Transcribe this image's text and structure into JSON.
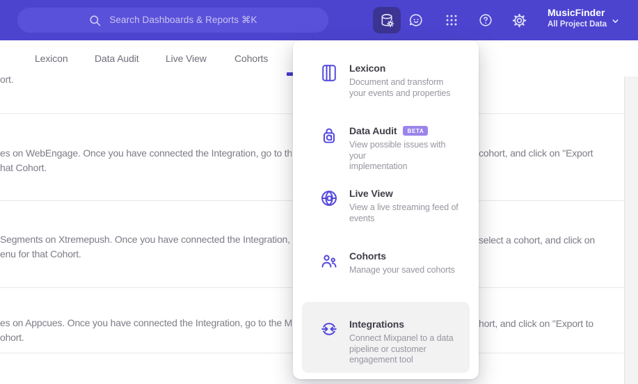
{
  "header": {
    "search": {
      "placeholder": "Search Dashboards & Reports ⌘K",
      "icon": "search-icon"
    },
    "nav_icons": [
      "data-management-icon",
      "feedback-bubble-icon",
      "apps-grid-icon",
      "help-icon",
      "settings-gear-icon"
    ],
    "active_nav_icon": "data-management-icon",
    "project": {
      "name": "MusicFinder",
      "scope": "All Project Data"
    }
  },
  "tabs": [
    {
      "label": "Lexicon"
    },
    {
      "label": "Data Audit"
    },
    {
      "label": "Live View"
    },
    {
      "label": "Cohorts"
    }
  ],
  "menu": {
    "items": [
      {
        "title": "Lexicon",
        "icon": "book-icon",
        "desc_lines": [
          "Document and transform",
          "your events and properties"
        ]
      },
      {
        "title": "Data Audit",
        "icon": "audit-lock-icon",
        "badge": "BETA",
        "desc_lines": [
          "View possible issues with your",
          "implementation"
        ]
      },
      {
        "title": "Live View",
        "icon": "globe-icon",
        "desc_lines": [
          "View a live streaming feed of",
          "events"
        ]
      },
      {
        "title": "Cohorts",
        "icon": "people-icon",
        "desc_lines": [
          "Manage your saved cohorts"
        ]
      },
      {
        "title": "Integrations",
        "icon": "sync-arrows-icon",
        "highlighted": true,
        "desc_lines": [
          "Connect Mixpanel to a data",
          "pipeline or customer",
          "engagement tool"
        ]
      }
    ]
  },
  "content_rows": [
    {
      "left_line1": "ort.",
      "left_line2": "",
      "right_line1": ""
    },
    {
      "left_line1": "es on WebEngage. Once you have connected the Integration, go to the",
      "left_line2": "hat Cohort.",
      "right_line1": "cohort, and click on \"Export"
    },
    {
      "left_line1": "Segments on Xtremepush. Once you have connected the Integration,",
      "left_line2": "enu for that Cohort.",
      "right_line1": "select a cohort, and click on"
    },
    {
      "left_line1": "es on Appcues. Once you have connected the Integration, go to the M",
      "left_line2": "ohort.",
      "right_line1": "hort, and click on \"Export to"
    }
  ],
  "colors": {
    "header_bg": "#4c44cf",
    "search_pill_bg": "#5a51da",
    "active_nav_bg": "#3c3492",
    "accent_icon": "#5246dd",
    "tab_indicator": "#4437d1",
    "badge_bg": "#9b84ec",
    "highlight_row_bg": "#f2f2f3",
    "divider": "#e8e8ea",
    "body_text": "#7c7c86"
  }
}
